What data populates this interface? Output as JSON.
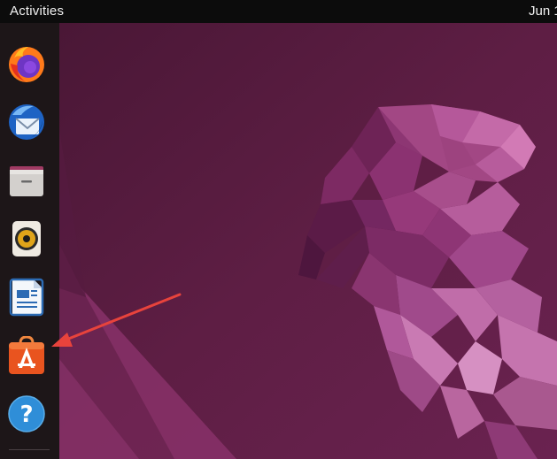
{
  "topbar": {
    "activities_label": "Activities",
    "clock_text": "Jun 1"
  },
  "dock": {
    "items": [
      {
        "name": "Firefox",
        "icon": "firefox-icon"
      },
      {
        "name": "Thunderbird",
        "icon": "thunderbird-icon"
      },
      {
        "name": "Files",
        "icon": "files-icon"
      },
      {
        "name": "Rhythmbox",
        "icon": "rhythmbox-icon"
      },
      {
        "name": "LibreOffice Writer",
        "icon": "libreoffice-writer-icon"
      },
      {
        "name": "Ubuntu Software",
        "icon": "ubuntu-software-icon"
      },
      {
        "name": "Help",
        "icon": "help-icon"
      }
    ]
  },
  "colors": {
    "wallpaper_base": "#5e1e44",
    "wallpaper_accent": "#8a2e6c",
    "dock_bg": "#1d1618",
    "topbar_bg": "#0c0c0c",
    "annotation_arrow": "#e8433c"
  }
}
